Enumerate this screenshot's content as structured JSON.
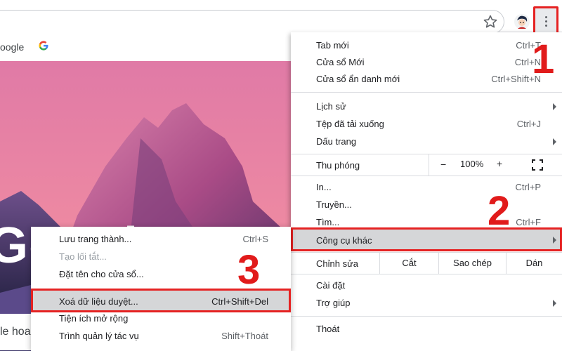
{
  "bookmarks": {
    "text": "oogle"
  },
  "page": {
    "google_text": "Google",
    "search_partial": "le hoa"
  },
  "menu": {
    "items_group1": [
      {
        "label": "Tab mới",
        "shortcut": "Ctrl+T"
      },
      {
        "label": "Cửa sổ Mới",
        "shortcut": "Ctrl+N"
      },
      {
        "label": "Cửa sổ ẩn danh mới",
        "shortcut": "Ctrl+Shift+N"
      }
    ],
    "items_group2": [
      {
        "label": "Lịch sử",
        "shortcut": ""
      },
      {
        "label": "Tệp đã tải xuống",
        "shortcut": "Ctrl+J"
      },
      {
        "label": "Dấu trang",
        "shortcut": ""
      }
    ],
    "zoom": {
      "label": "Thu phóng",
      "minus": "−",
      "value": "100%",
      "plus": "+"
    },
    "items_group3": [
      {
        "label": "In...",
        "shortcut": "Ctrl+P"
      },
      {
        "label": "Truyền...",
        "shortcut": ""
      },
      {
        "label": "Tìm...",
        "shortcut": "Ctrl+F"
      }
    ],
    "more_tools": "Công cụ khác",
    "edit": {
      "label": "Chỉnh sửa",
      "cut": "Cắt",
      "copy": "Sao chép",
      "paste": "Dán"
    },
    "settings": "Cài đặt",
    "help": "Trợ giúp",
    "exit": "Thoát"
  },
  "submenu": {
    "save_page": {
      "label": "Lưu trang thành...",
      "shortcut": "Ctrl+S"
    },
    "create_shortcut": {
      "label": "Tạo lối tắt..."
    },
    "name_window": {
      "label": "Đặt tên cho cửa sổ..."
    },
    "clear_data": {
      "label": "Xoá dữ liệu duyệt...",
      "shortcut": "Ctrl+Shift+Del"
    },
    "extensions": {
      "label": "Tiện ích mở rộng"
    },
    "task_manager": {
      "label": "Trình quản lý tác vụ",
      "shortcut": "Shift+Thoát"
    }
  },
  "steps": {
    "one": "1",
    "two": "2",
    "three": "3"
  },
  "colors": {
    "highlight": "#e52222",
    "selected_bg": "#d5d6d8",
    "step_red": "#e11b1b"
  }
}
